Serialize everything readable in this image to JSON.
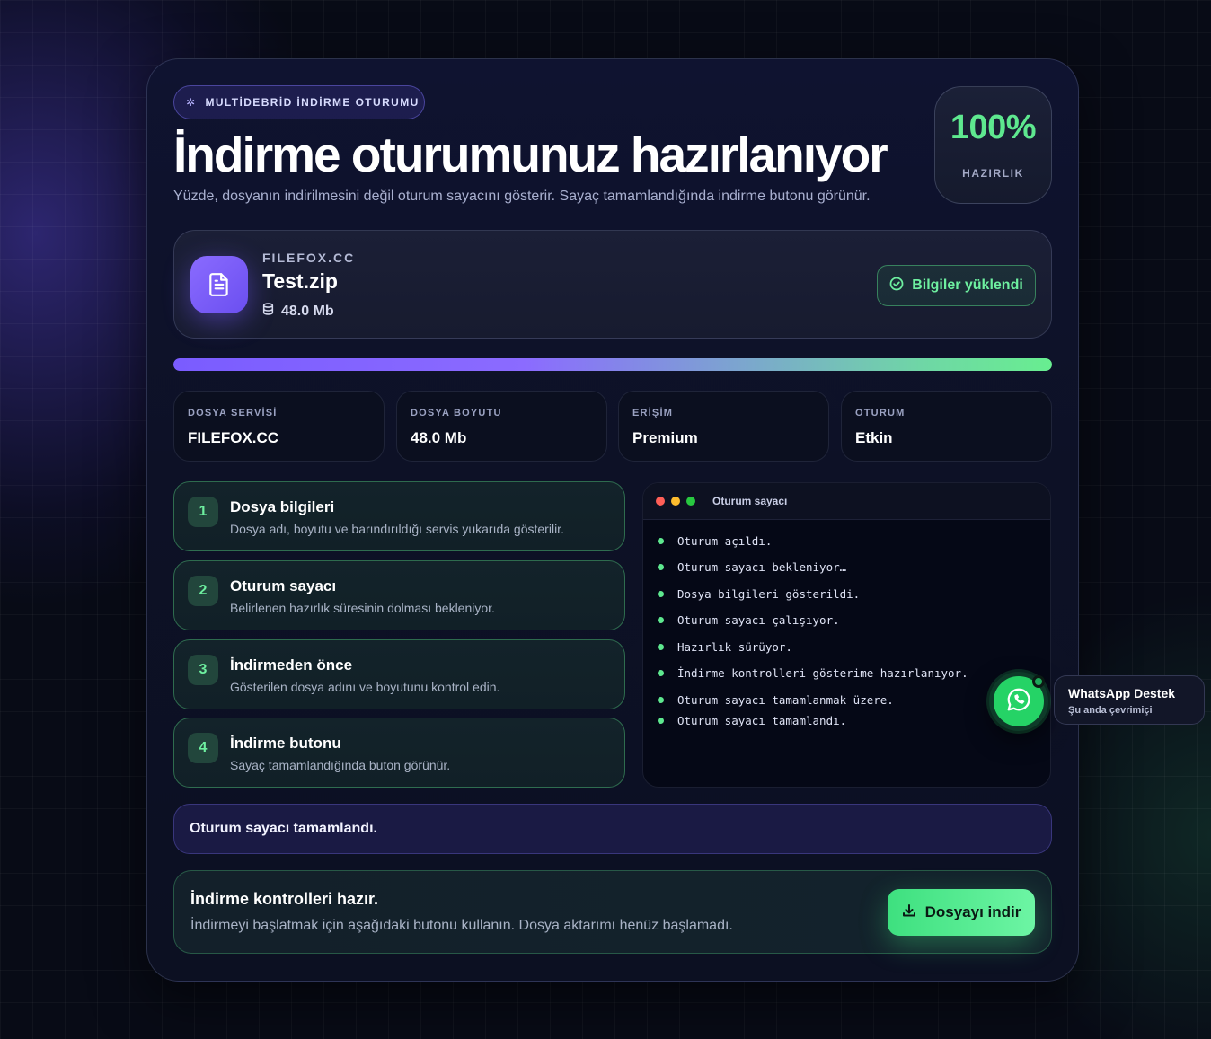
{
  "header": {
    "badge_icon": "sparkle-icon",
    "badge": "MULTİDEBRİD İNDİRME OTURUMU",
    "title": "İndirme oturumunuz hazırlanıyor",
    "subtitle": "Yüzde, dosyanın indirilmesini değil oturum sayacını gösterir. Sayaç tamamlandığında indirme butonu görünür."
  },
  "readiness": {
    "percent_text": "100%",
    "label": "HAZIRLIK",
    "progress": 1.0
  },
  "file": {
    "host": "FILEFOX.CC",
    "name": "Test.zip",
    "size": "48.0 Mb",
    "status_label": "Bilgiler yüklendi"
  },
  "stats": [
    {
      "key": "DOSYA SERVİSİ",
      "value": "FILEFOX.CC"
    },
    {
      "key": "DOSYA BOYUTU",
      "value": "48.0 Mb"
    },
    {
      "key": "ERİŞİM",
      "value": "Premium"
    },
    {
      "key": "OTURUM",
      "value": "Etkin"
    }
  ],
  "steps": [
    {
      "num": "1",
      "title": "Dosya bilgileri",
      "desc": "Dosya adı, boyutu ve barındırıldığı servis yukarıda gösterilir."
    },
    {
      "num": "2",
      "title": "Oturum sayacı",
      "desc": "Belirlenen hazırlık süresinin dolması bekleniyor."
    },
    {
      "num": "3",
      "title": "İndirmeden önce",
      "desc": "Gösterilen dosya adını ve boyutunu kontrol edin."
    },
    {
      "num": "4",
      "title": "İndirme butonu",
      "desc": "Sayaç tamamlandığında buton görünür."
    }
  ],
  "terminal": {
    "title": "Oturum sayacı",
    "lines": [
      "Oturum açıldı.",
      "Oturum sayacı bekleniyor…",
      "Dosya bilgileri gösterildi.",
      "Oturum sayacı çalışıyor.",
      "Hazırlık sürüyor.",
      "İndirme kontrolleri gösterime hazırlanıyor.",
      "Oturum sayacı tamamlanmak üzere.",
      "Oturum sayacı tamamlandı."
    ]
  },
  "status_message": "Oturum sayacı tamamlandı.",
  "ready": {
    "title": "İndirme kontrolleri hazır.",
    "desc": "İndirmeyi başlatmak için aşağıdaki butonu kullanın. Dosya aktarımı henüz başlamadı.",
    "button": "Dosyayı indir"
  },
  "whatsapp": {
    "title": "WhatsApp Destek",
    "status": "Şu anda çevrimiçi"
  },
  "colors": {
    "accent_green": "#5ee88f",
    "accent_purple": "#7a5cff",
    "whatsapp": "#25d366"
  }
}
